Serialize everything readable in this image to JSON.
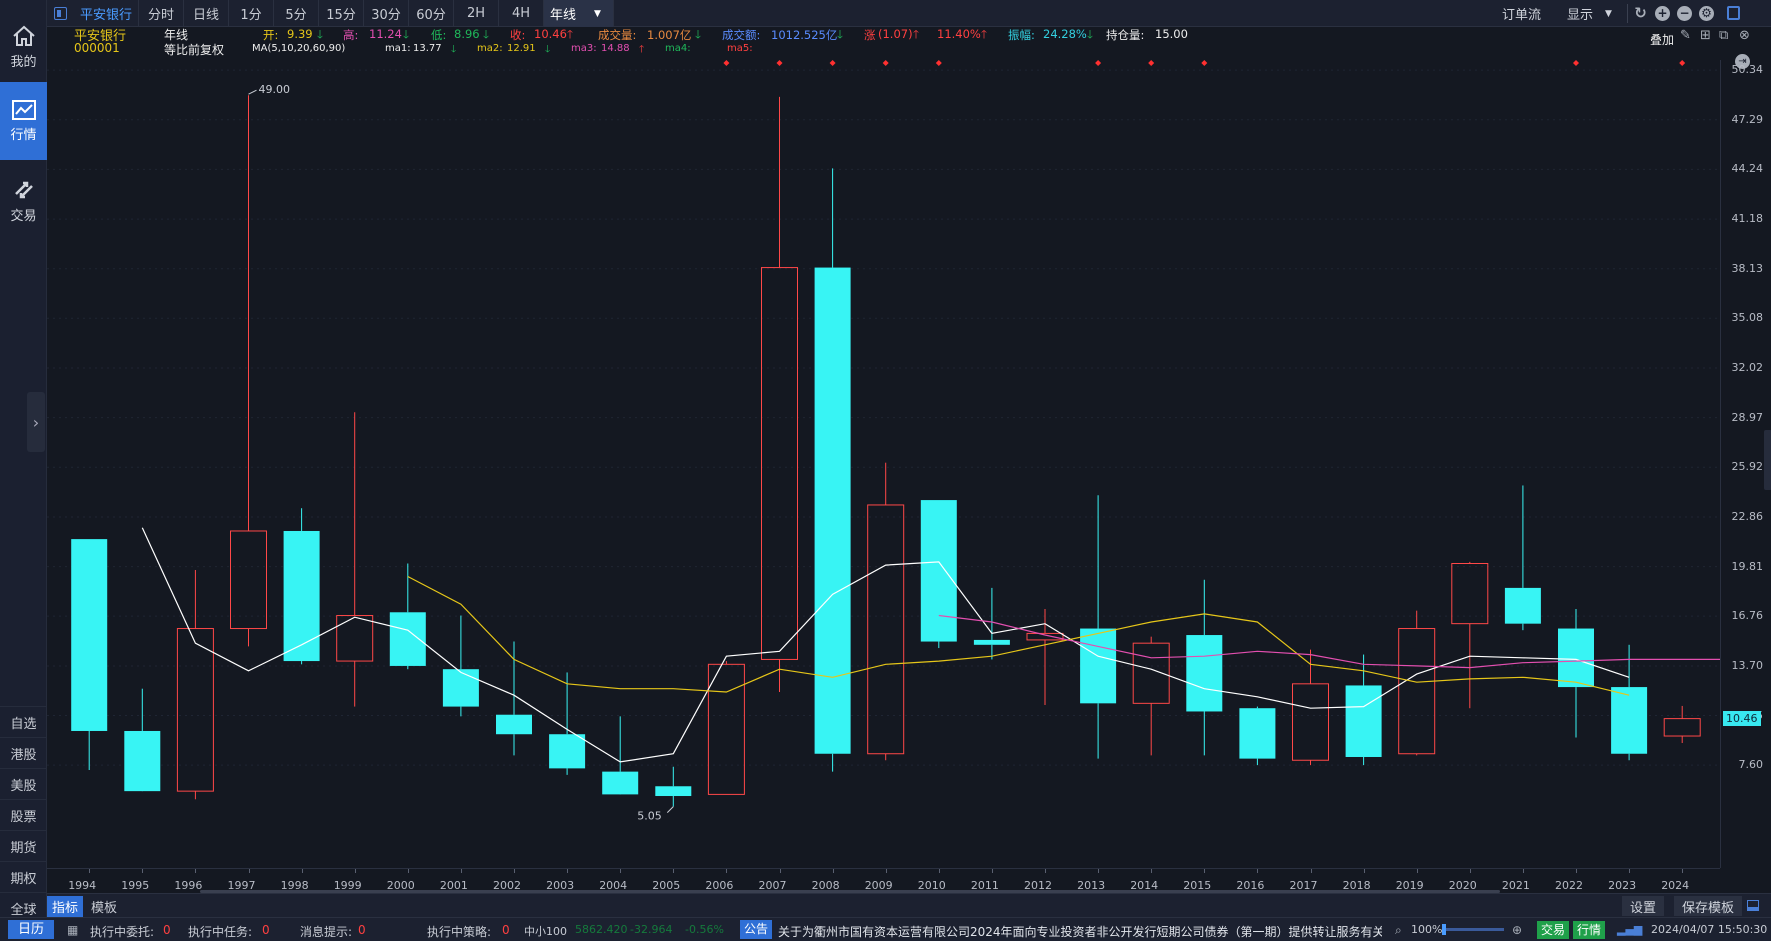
{
  "sidebar": {
    "nav": [
      {
        "label": "我的",
        "icon": "home-icon"
      },
      {
        "label": "行情",
        "icon": "chart-icon"
      },
      {
        "label": "交易",
        "icon": "transfer-icon"
      }
    ],
    "markets": [
      "自选",
      "港股",
      "美股",
      "股票",
      "期货",
      "期权",
      "全球"
    ]
  },
  "topbar": {
    "stock_tab": "平安银行",
    "periods": [
      "分时",
      "日线",
      "1分",
      "5分",
      "15分",
      "30分",
      "60分",
      "2H",
      "4H"
    ],
    "active_period": "年线",
    "order_flow": "订单流",
    "display": "显示"
  },
  "info": {
    "name": "平安银行",
    "code": "000001",
    "period": "年线",
    "adjust": "等比前复权",
    "open_label": "开:",
    "open": "9.39",
    "high_label": "高:",
    "high": "11.24",
    "low_label": "低:",
    "low": "8.96",
    "close_label": "收:",
    "close": "10.46",
    "volume_label": "成交量:",
    "volume": "1.007亿",
    "amount_label": "成交额:",
    "amount": "1012.525亿",
    "change_label": "涨",
    "change": "(1.07)",
    "change_pct": "11.40%",
    "amplitude_label": "振幅:",
    "amplitude": "24.28%",
    "oi_label": "持仓量:",
    "oi": "15.00",
    "ma_label": "MA(5,10,20,60,90)",
    "ma1_label": "ma1:",
    "ma1": "13.77",
    "ma2_label": "ma2:",
    "ma2": "12.91",
    "ma3_label": "ma3:",
    "ma3": "14.88",
    "ma4_label": "ma4:",
    "ma5_label": "ma5:",
    "overlay": "叠加"
  },
  "chart_data": {
    "type": "candlestick",
    "years": [
      "1994",
      "1995",
      "1996",
      "1997",
      "1998",
      "1999",
      "2000",
      "2001",
      "2002",
      "2003",
      "2004",
      "2005",
      "2006",
      "2007",
      "2008",
      "2009",
      "2010",
      "2011",
      "2012",
      "2013",
      "2014",
      "2015",
      "2016",
      "2017",
      "2018",
      "2019",
      "2020",
      "2021",
      "2022",
      "2023",
      "2024"
    ],
    "open": [
      21.5,
      9.7,
      6.0,
      16.0,
      22.0,
      14.0,
      17.0,
      13.5,
      10.7,
      9.5,
      7.2,
      6.3,
      5.8,
      14.1,
      38.2,
      8.3,
      23.9,
      15.3,
      15.3,
      16.0,
      11.4,
      15.6,
      11.1,
      7.9,
      12.5,
      8.3,
      16.3,
      18.5,
      16.0,
      12.4,
      9.39
    ],
    "high": [
      21.5,
      12.3,
      19.6,
      48.8,
      23.4,
      29.3,
      20.0,
      16.8,
      15.2,
      13.3,
      10.6,
      7.5,
      14.0,
      48.7,
      44.3,
      26.2,
      23.9,
      18.5,
      17.2,
      24.2,
      15.5,
      19.0,
      11.2,
      14.7,
      14.4,
      17.1,
      20.1,
      24.8,
      17.2,
      15.0,
      11.24
    ],
    "low": [
      7.3,
      6.2,
      5.5,
      14.9,
      13.8,
      11.2,
      13.5,
      10.6,
      8.2,
      7.0,
      5.9,
      5.05,
      5.8,
      12.1,
      7.2,
      7.9,
      14.8,
      14.1,
      11.3,
      8.0,
      8.2,
      8.2,
      7.6,
      7.6,
      7.6,
      8.2,
      11.1,
      15.9,
      9.3,
      7.9,
      8.96
    ],
    "close": [
      9.7,
      6.0,
      16.0,
      22.0,
      14.0,
      16.8,
      13.7,
      11.2,
      9.5,
      7.4,
      5.8,
      5.7,
      13.8,
      38.2,
      8.3,
      23.6,
      15.2,
      15.0,
      15.7,
      11.4,
      15.1,
      10.9,
      8.0,
      12.6,
      8.1,
      16.0,
      20.0,
      16.3,
      12.4,
      8.3,
      10.46
    ],
    "ma1": [
      null,
      22.2,
      15.1,
      13.4,
      15.0,
      16.7,
      15.9,
      13.3,
      11.9,
      9.8,
      7.8,
      8.3,
      14.3,
      14.6,
      18.1,
      19.9,
      20.1,
      15.7,
      16.3,
      14.3,
      13.5,
      12.3,
      11.8,
      11.1,
      11.2,
      13.2,
      14.3,
      14.2,
      14.1,
      13.0
    ],
    "ma2": [
      19.2,
      17.5,
      14.1,
      12.6,
      12.3,
      12.3,
      12.1,
      13.5,
      13.0,
      13.8,
      14.0,
      14.3,
      15.0,
      15.7,
      16.4,
      16.9,
      16.4,
      13.8,
      13.4,
      12.7,
      12.9,
      13.0,
      12.7,
      11.9
    ],
    "ma2_start": 6,
    "ma3": [
      16.8,
      16.4,
      15.6,
      14.9,
      14.2,
      14.3,
      14.6,
      14.4,
      13.8,
      13.7,
      13.6,
      13.9,
      14.0,
      14.1,
      14.1,
      14.1
    ],
    "ma3_start": 16,
    "price_ticks": [
      "50.34",
      "47.29",
      "44.24",
      "41.18",
      "38.13",
      "35.08",
      "32.02",
      "28.97",
      "25.92",
      "22.86",
      "19.81",
      "16.76",
      "13.70",
      "10.65",
      "7.60"
    ],
    "high_annotation": "49.00",
    "low_annotation": "5.05",
    "last_price": "10.46"
  },
  "bottom": {
    "tabs": [
      "指标",
      "模板"
    ],
    "settings": "设置",
    "save_template": "保存模板"
  },
  "status": {
    "calendar": "日历",
    "orders_label": "执行中委托:",
    "orders": "0",
    "tasks_label": "执行中任务:",
    "tasks": "0",
    "msg_label": "消息提示:",
    "msg": "0",
    "strategy_label": "执行中策略:",
    "strategy": "0",
    "index_name": "中小100",
    "index_value": "5862.420",
    "index_change": "-32.964",
    "index_pct": "-0.56%",
    "notice_label": "公告",
    "notice": "关于为衢州市国有资本运营有限公司2024年面向专业投资者非公开发行短期公司债券（第一期）提供转让服务有关",
    "zoom": "100%",
    "trade": "交易",
    "quote": "行情",
    "datetime": "2024/04/07 15:50:30"
  }
}
